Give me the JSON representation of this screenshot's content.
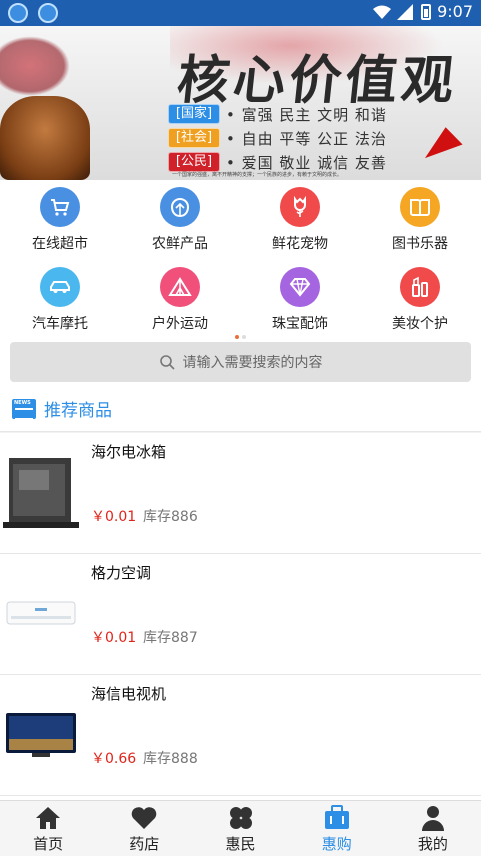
{
  "status_bar": {
    "time": "9:07"
  },
  "banner": {
    "calligraphy": "核心价值观",
    "rows": [
      {
        "tag": "[国家]",
        "tag_color": "#2d8ee6",
        "text": "• 富强  民主  文明  和谐"
      },
      {
        "tag": "[社会]",
        "tag_color": "#f0a020",
        "text": "• 自由  平等  公正  法治"
      },
      {
        "tag": "[公民]",
        "tag_color": "#d0202a",
        "text": "• 爱国  敬业  诚信  友善"
      }
    ],
    "footnote": "一个国家的强盛，离不开精神的支撑；一个民族的进步，有赖于文明的成长。"
  },
  "categories": [
    {
      "label": "在线超市",
      "color": "#4a90e2",
      "icon": "cart-icon"
    },
    {
      "label": "农鲜产品",
      "color": "#4a90e2",
      "icon": "cabbage-icon"
    },
    {
      "label": "鲜花宠物",
      "color": "#f04a4a",
      "icon": "flower-icon"
    },
    {
      "label": "图书乐器",
      "color": "#f5a623",
      "icon": "book-icon"
    },
    {
      "label": "汽车摩托",
      "color": "#4ab8ee",
      "icon": "car-icon"
    },
    {
      "label": "户外运动",
      "color": "#f0507a",
      "icon": "tent-icon"
    },
    {
      "label": "珠宝配饰",
      "color": "#a564e0",
      "icon": "diamond-icon"
    },
    {
      "label": "美妆个护",
      "color": "#f04a4a",
      "icon": "cosmetics-icon"
    }
  ],
  "search": {
    "placeholder": "请输入需要搜索的内容"
  },
  "section": {
    "title": "推荐商品"
  },
  "products": [
    {
      "name": "海尔电冰箱",
      "price": "￥0.01",
      "stock": "库存886",
      "thumb": "fridge"
    },
    {
      "name": "格力空调",
      "price": "￥0.01",
      "stock": "库存887",
      "thumb": "aircon"
    },
    {
      "name": "海信电视机",
      "price": "￥0.66",
      "stock": "库存888",
      "thumb": "tv"
    }
  ],
  "tabs": [
    {
      "label": "首页",
      "icon": "home-icon",
      "active": false
    },
    {
      "label": "药店",
      "icon": "heart-icon",
      "active": false
    },
    {
      "label": "惠民",
      "icon": "clover-icon",
      "active": false
    },
    {
      "label": "惠购",
      "icon": "briefcase-icon",
      "active": true
    },
    {
      "label": "我的",
      "icon": "user-icon",
      "active": false
    }
  ],
  "colors": {
    "accent": "#2d8ee6",
    "price": "#e0241a"
  }
}
